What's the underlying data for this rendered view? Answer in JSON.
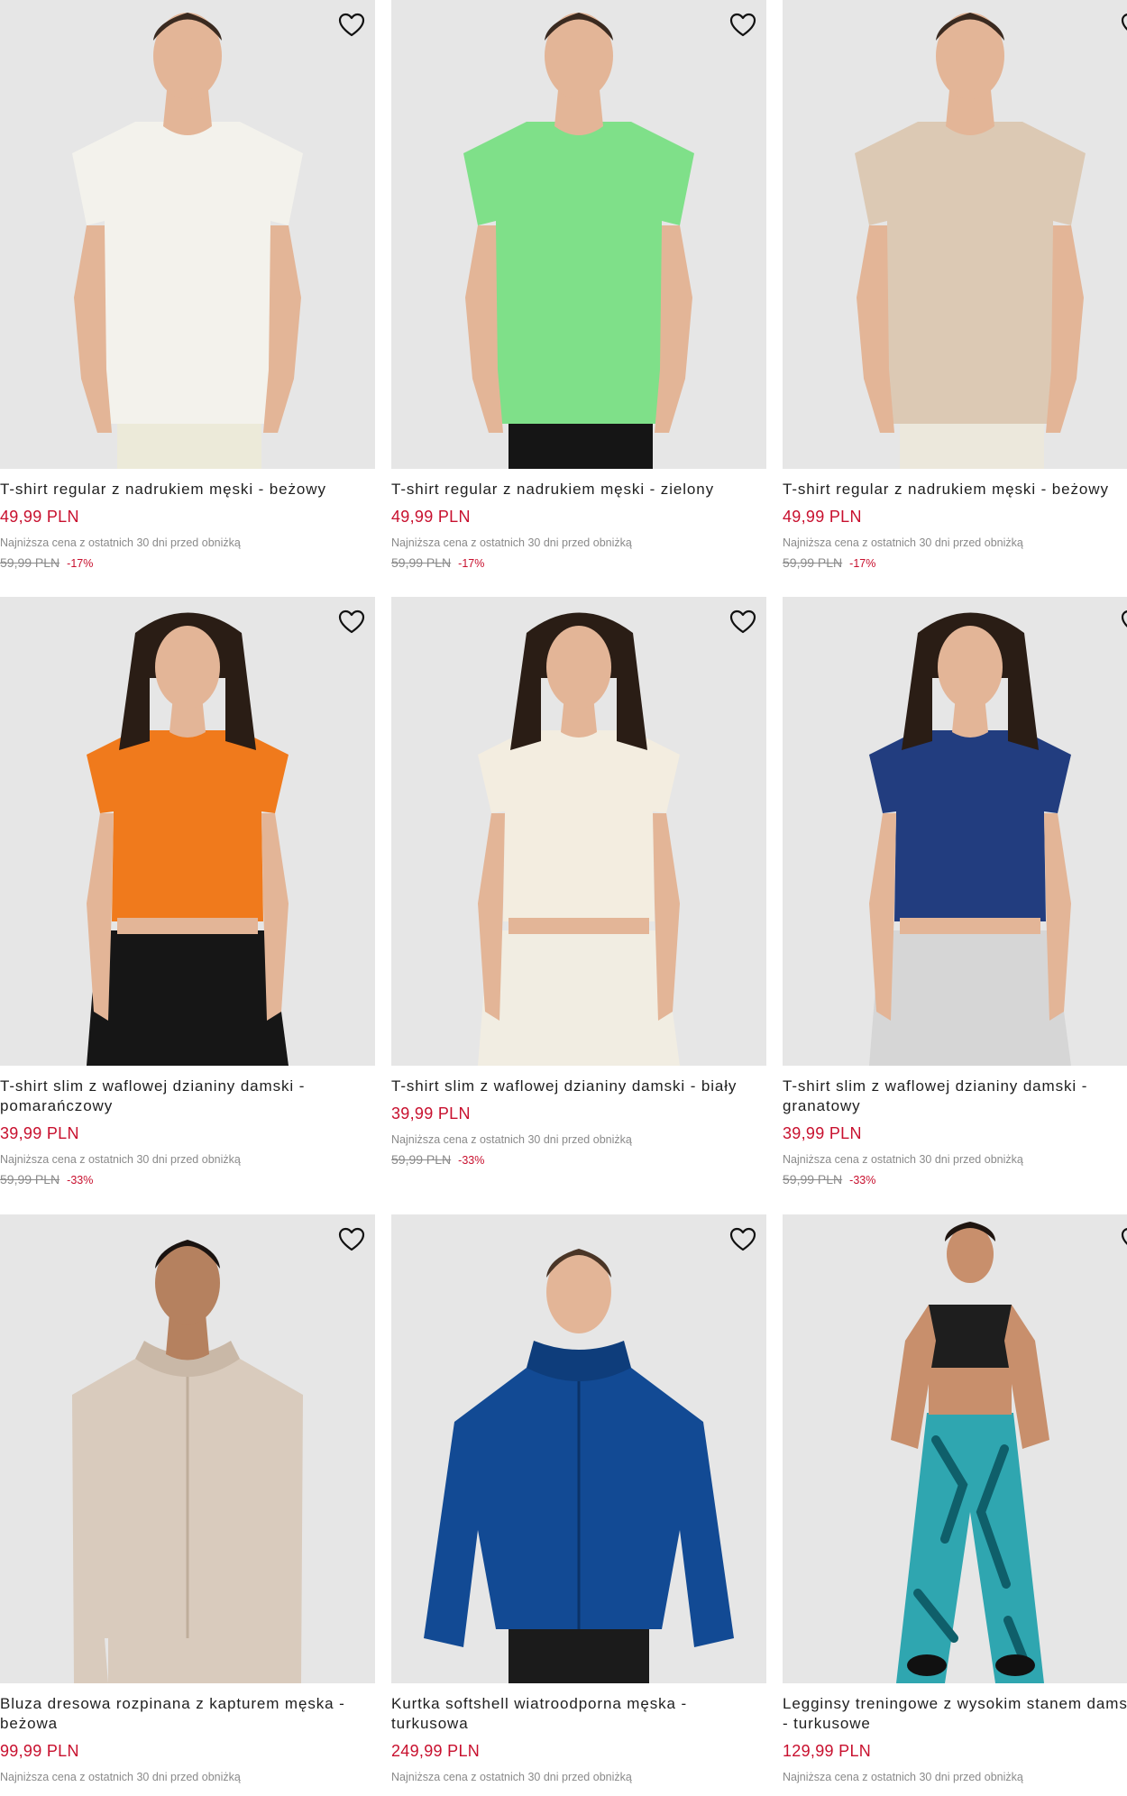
{
  "products": [
    {
      "title": "T-shirt regular z nadrukiem męski - beżowy",
      "price": "49,99 PLN",
      "lowest_label": "Najniższa cena z ostatnich 30 dni przed obniżką",
      "old_price": "59,99 PLN",
      "discount": "-17%",
      "top_color": "#f3f2ec",
      "bottom_color": "#ecead9",
      "figure": "man-tshirt"
    },
    {
      "title": "T-shirt regular z nadrukiem męski - zielony",
      "price": "49,99 PLN",
      "lowest_label": "Najniższa cena z ostatnich 30 dni przed obniżką",
      "old_price": "59,99 PLN",
      "discount": "-17%",
      "top_color": "#7fe089",
      "bottom_color": "#151515",
      "figure": "man-tshirt"
    },
    {
      "title": "T-shirt regular z nadrukiem męski - beżowy",
      "price": "49,99 PLN",
      "lowest_label": "Najniższa cena z ostatnich 30 dni przed obniżką",
      "old_price": "59,99 PLN",
      "discount": "-17%",
      "top_color": "#dcc9b4",
      "bottom_color": "#ece8dc",
      "figure": "man-tshirt"
    },
    {
      "title": "T-shirt slim z waflowej dzianiny damski - pomarańczowy",
      "price": "39,99 PLN",
      "lowest_label": "Najniższa cena z ostatnich 30 dni przed obniżką",
      "old_price": "59,99 PLN",
      "discount": "-33%",
      "top_color": "#f07a1c",
      "bottom_color": "#161616",
      "figure": "woman-crop"
    },
    {
      "title": "T-shirt slim z waflowej dzianiny damski - biały",
      "price": "39,99 PLN",
      "lowest_label": "Najniższa cena z ostatnich 30 dni przed obniżką",
      "old_price": "59,99 PLN",
      "discount": "-33%",
      "top_color": "#f3ede0",
      "bottom_color": "#f1ede2",
      "figure": "woman-crop"
    },
    {
      "title": "T-shirt slim z waflowej dzianiny damski - granatowy",
      "price": "39,99 PLN",
      "lowest_label": "Najniższa cena z ostatnich 30 dni przed obniżką",
      "old_price": "59,99 PLN",
      "discount": "-33%",
      "top_color": "#223d7f",
      "bottom_color": "#d6d6d6",
      "figure": "woman-crop"
    },
    {
      "title": "Bluza dresowa rozpinana z kapturem męska - beżowa",
      "price": "99,99 PLN",
      "lowest_label": "Najniższa cena z ostatnich 30 dni przed obniżką",
      "top_color": "#d9cbbd",
      "bottom_color": "#d9cbbd",
      "figure": "man-hoodie"
    },
    {
      "title": "Kurtka softshell wiatroodporna męska - turkusowa",
      "price": "249,99 PLN",
      "lowest_label": "Najniższa cena z ostatnich 30 dni przed obniżką",
      "top_color": "#124a94",
      "bottom_color": "#1b1b1b",
      "figure": "man-jacket"
    },
    {
      "title": "Legginsy treningowe z wysokim stanem damskie - turkusowe",
      "price": "129,99 PLN",
      "lowest_label": "Najniższa cena z ostatnich 30 dni przed obniżką",
      "top_color": "#1e1e1e",
      "bottom_color": "#2fa6b0",
      "figure": "woman-leggings"
    }
  ],
  "icons": {
    "wishlist": "heart-outline-icon"
  },
  "colors": {
    "price": "#c8102e",
    "muted": "#8a8a8a",
    "photo_bg": "#e6e6e6"
  }
}
